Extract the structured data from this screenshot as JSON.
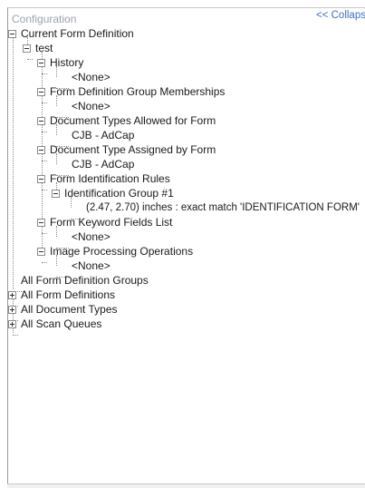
{
  "panel": {
    "title": "Configuration",
    "collapse_label": "<< Collapse"
  },
  "tree": {
    "current_form_definition": "Current Form Definition",
    "form_name": "test",
    "history": "History",
    "history_value": "<None>",
    "group_memberships": "Form Definition Group Memberships",
    "group_memberships_value": "<None>",
    "doc_types_allowed": "Document Types Allowed for Form",
    "doc_types_allowed_value": "CJB - AdCap",
    "doc_type_assigned": "Document Type Assigned by Form",
    "doc_type_assigned_value": "CJB - AdCap",
    "identification_rules": "Form Identification Rules",
    "identification_group": "Identification Group #1",
    "identification_rule": "(2.47, 2.70) inches : exact match 'IDENTIFICATION FORM'",
    "keyword_fields": "Form Keyword Fields List",
    "keyword_fields_value": "<None>",
    "image_processing": "Image Processing Operations",
    "image_processing_value": "<None>",
    "all_form_definition_groups": "All Form Definition Groups",
    "all_form_definitions": "All Form Definitions",
    "all_document_types": "All Document Types",
    "all_scan_queues": "All Scan Queues"
  }
}
